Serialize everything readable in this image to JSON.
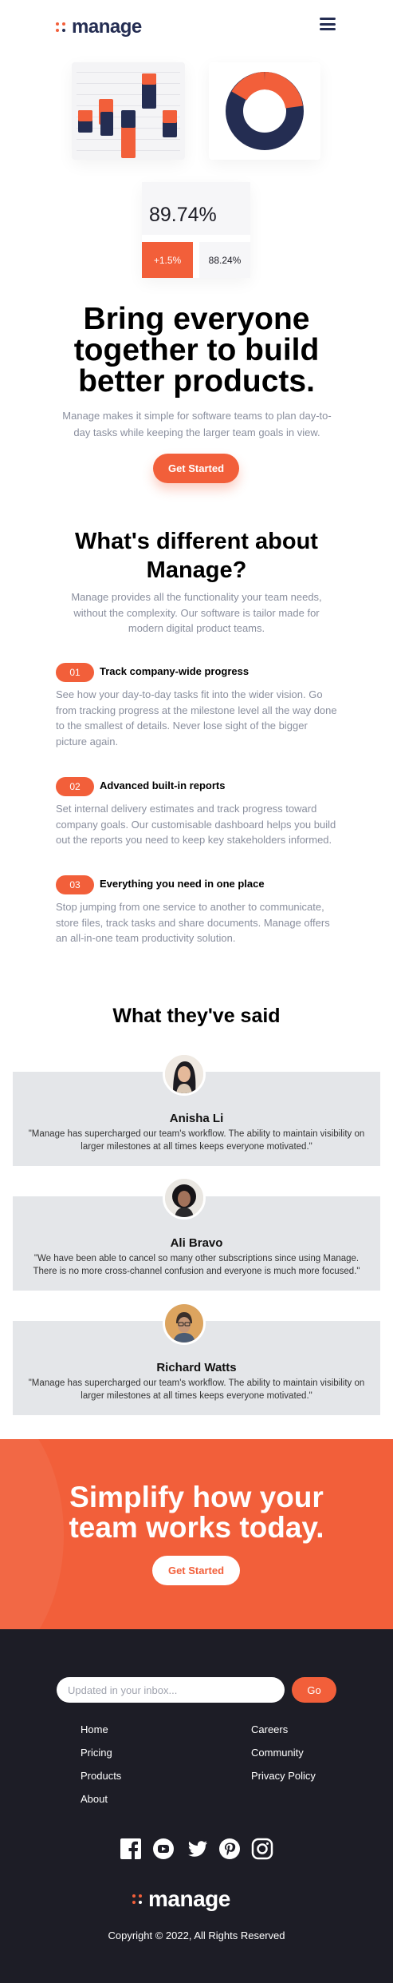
{
  "header": {
    "logo_text": "manage",
    "menu_icon": "hamburger-menu-icon"
  },
  "hero": {
    "stat_value": "89.74%",
    "stat_change": "+1.5%",
    "stat_secondary": "88.24%",
    "title": "Bring everyone together to build better products.",
    "subtitle": "Manage makes it simple for software teams to plan day-to-day tasks while keeping the larger team goals in view.",
    "cta_label": "Get Started"
  },
  "features": {
    "title": "What's different about Manage?",
    "subtitle": "Manage provides all the functionality your team needs, without the complexity. Our software is tailor made for modern digital product teams.",
    "items": [
      {
        "num": "01",
        "heading": "Track company-wide progress",
        "body": "See how your day-to-day tasks fit into the wider vision. Go from tracking progress at the milestone level all the way done to the smallest of details. Never lose sight of the bigger picture again."
      },
      {
        "num": "02",
        "heading": "Advanced built-in reports",
        "body": "Set internal delivery estimates and track progress toward company goals. Our customisable dashboard helps you build out the reports you need to keep key stakeholders informed."
      },
      {
        "num": "03",
        "heading": "Everything you need in one place",
        "body": "Stop jumping from one service to another to communicate, store files, track tasks and share documents. Manage offers an all-in-one team productivity solution."
      }
    ]
  },
  "testimonials": {
    "title": "What they've said",
    "items": [
      {
        "name": "Anisha Li",
        "quote": "\"Manage has supercharged our team's workflow. The ability to maintain visibility on larger milestones at all times keeps everyone motivated.\""
      },
      {
        "name": "Ali Bravo",
        "quote": "\"We have been able to cancel so many other subscriptions since using Manage. There is no more cross-channel confusion and everyone is much more focused.\""
      },
      {
        "name": "Richard Watts",
        "quote": "\"Manage has supercharged our team's workflow. The ability to maintain visibility on larger milestones at all times keeps everyone motivated.\""
      }
    ]
  },
  "cta": {
    "title": "Simplify how your team works today.",
    "button_label": "Get Started"
  },
  "footer": {
    "newsletter": {
      "placeholder": "Updated in your inbox...",
      "button_label": "Go"
    },
    "links_left": [
      "Home",
      "Pricing",
      "Products",
      "About"
    ],
    "links_right": [
      "Careers",
      "Community",
      "Privacy Policy"
    ],
    "social_icons": [
      "facebook-icon",
      "youtube-icon",
      "twitter-icon",
      "pinterest-icon",
      "instagram-icon"
    ],
    "logo_text": "manage",
    "copyright": "Copyright © 2022, All Rights Reserved"
  },
  "colors": {
    "accent": "#f25f3a",
    "navy": "#242d52",
    "footer_bg": "#1d1d26",
    "testimonial_bg": "#e4e6e9"
  }
}
